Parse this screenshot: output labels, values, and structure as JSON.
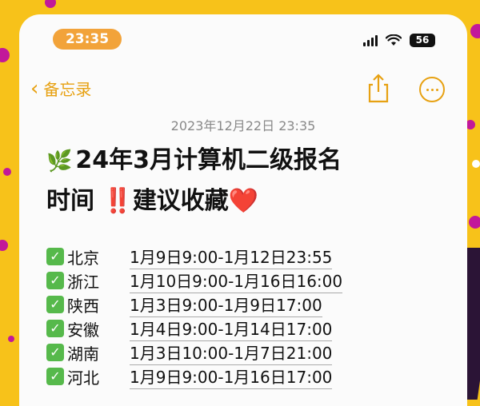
{
  "status_bar": {
    "time": "23:35",
    "battery": "56"
  },
  "nav": {
    "back_label": "备忘录"
  },
  "note": {
    "date": "2023年12月22日 23:35",
    "title_line1": "24年3月计算机二级报名",
    "title_line2_text": "时间",
    "title_line2_emph": "‼️",
    "title_line2_end": "建议收藏",
    "title_heart": "❤️",
    "leaf_icon": "🌿",
    "check_icon": "✓",
    "rows": [
      {
        "province": "北京",
        "time": "1月9日9:00-1月12日23:55"
      },
      {
        "province": "浙江",
        "time": "1月10日9:00-1月16日16:00"
      },
      {
        "province": "陕西",
        "time": "1月3日9:00-1月9日17:00"
      },
      {
        "province": "安徽",
        "time": "1月4日9:00-1月14日17:00"
      },
      {
        "province": "湖南",
        "time": "1月3日10:00-1月7日21:00"
      },
      {
        "province": "河北",
        "time": "1月9日9:00-1月16日17:00"
      }
    ]
  },
  "colors": {
    "accent": "#e7a112",
    "background": "#f7c21a",
    "decor": "#c2189a"
  }
}
